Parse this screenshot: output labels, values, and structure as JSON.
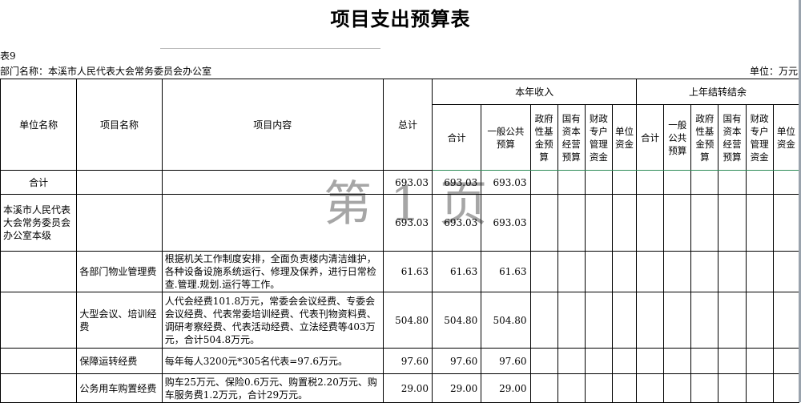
{
  "title": "项目支出预算表",
  "table_no": "表9",
  "dept_label": "部门名称：本溪市人民代表大会常务委员会办公室",
  "unit_label": "单位：万元",
  "watermark": "第 1 页",
  "headers": {
    "unit_name": "单位名称",
    "project_name": "项目名称",
    "project_content": "项目内容",
    "total": "总计",
    "current_year": "本年收入",
    "carryover": "上年结转结余",
    "cy_cols": [
      "合计",
      "一般公共预算",
      "政府性基金预算",
      "国有资本经营预算",
      "财政专户管理资金",
      "单位资金"
    ],
    "co_cols": [
      "合计",
      "一般公共预算",
      "政府性基金预算",
      "国有资本经营预算",
      "财政专户管理资金",
      "单位资金"
    ]
  },
  "rows": [
    {
      "unit": "合计",
      "project": "",
      "content": "",
      "total": "693.03",
      "cy_total": "693.03",
      "cy_general": "693.03"
    },
    {
      "unit": "本溪市人民代表大会常务委员会办公室本级",
      "project": "",
      "content": "",
      "total": "693.03",
      "cy_total": "693.03",
      "cy_general": "693.03"
    },
    {
      "unit": "",
      "project": "各部门物业管理费",
      "content": "根据机关工作制度安排，全面负责楼内清洁维护，各种设备设施系统运行、修理及保养，进行日常检查.管理.规划.运行等工作。",
      "total": "61.63",
      "cy_total": "61.63",
      "cy_general": "61.63"
    },
    {
      "unit": "",
      "project": "大型会议、培训经费",
      "content": "人代会经费101.8万元，常委会会议经费、专委会会议经费、代表常委培训经费、代表刊物资料费、调研考察经费、代表活动经费、立法经费等403万元，合计504.8万元。",
      "total": "504.80",
      "cy_total": "504.80",
      "cy_general": "504.80"
    },
    {
      "unit": "",
      "project": "保障运转经费",
      "content": "每年每人3200元*305名代表=97.6万元。",
      "total": "97.60",
      "cy_total": "97.60",
      "cy_general": "97.60"
    },
    {
      "unit": "",
      "project": "公务用车购置经费",
      "content": "购车25万元、保险0.6万元、购置税2.20万元、购车服务费1.2万元，合计29万元。",
      "total": "29.00",
      "cy_total": "29.00",
      "cy_general": "29.00"
    }
  ]
}
